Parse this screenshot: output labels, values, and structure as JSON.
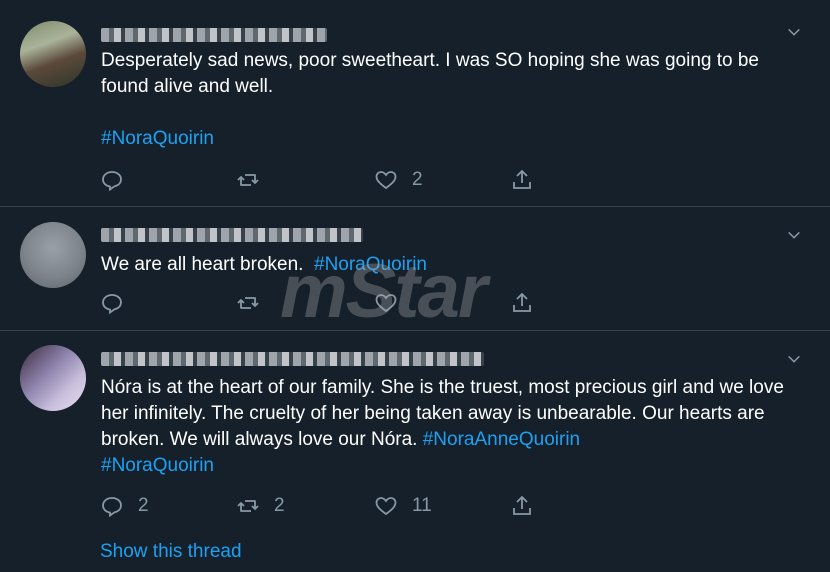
{
  "tweets": [
    {
      "text": "Desperately sad news, poor sweetheart. I was SO hoping she was going to be found alive and well.",
      "hashtag_line": "#NoraQuoirin",
      "reply_count": "",
      "retweet_count": "",
      "like_count": "2"
    },
    {
      "text": "We are all heart broken.",
      "hashtag": "#NoraQuoirin",
      "reply_count": "",
      "retweet_count": "",
      "like_count": ""
    },
    {
      "text": "Nóra is at the heart of our family. She is the truest, most precious girl and we love her infinitely. The cruelty of her being taken away is unbearable. Our hearts are broken. We will always love our Nóra.",
      "hashtag_inline": "#NoraAnneQuoirin",
      "hashtag_line": "#NoraQuoirin",
      "reply_count": "2",
      "retweet_count": "2",
      "like_count": "11"
    }
  ],
  "show_thread": "Show this thread",
  "watermark": "mStar",
  "colors": {
    "background": "#15202b",
    "hashtag": "#1da1f2",
    "icon": "#8899a6",
    "divider": "#38444d"
  }
}
